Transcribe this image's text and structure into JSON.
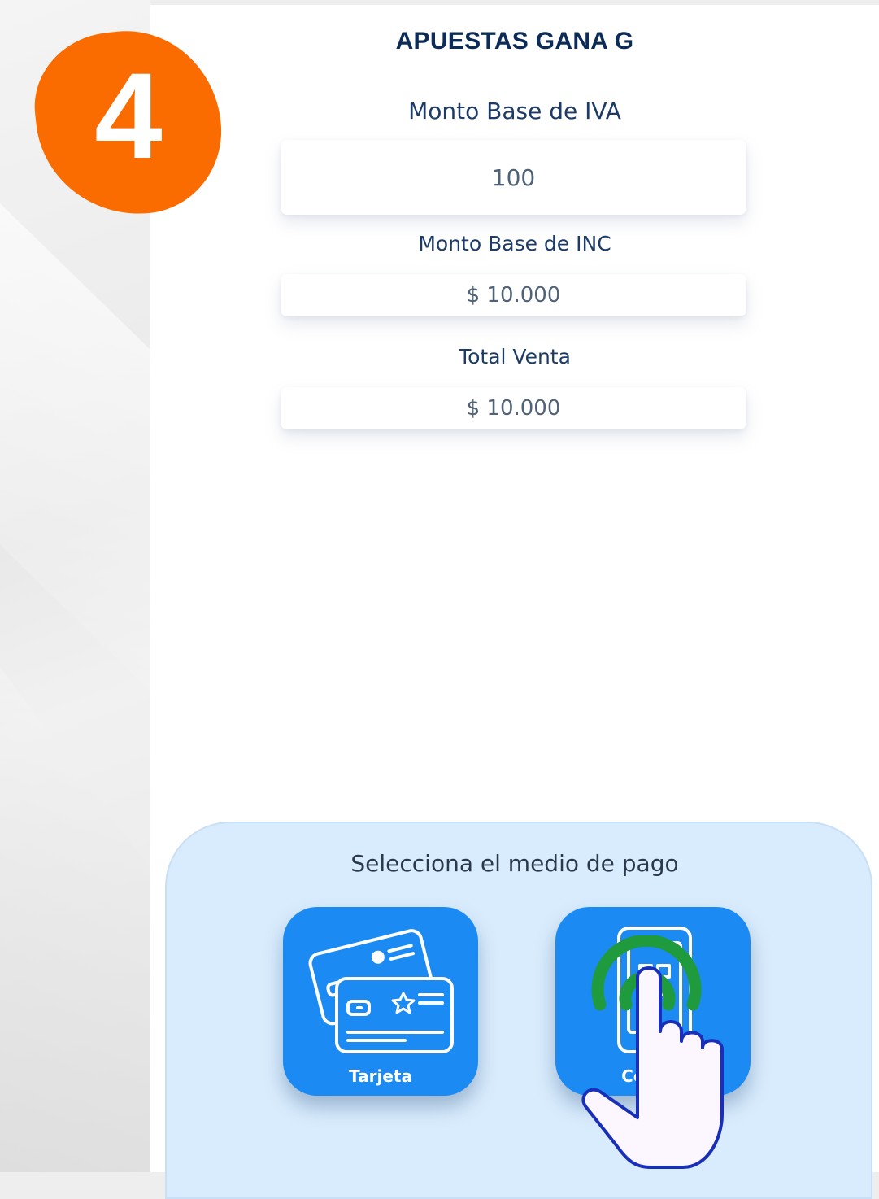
{
  "step_badge": {
    "number": "4",
    "color": "#fb6c00"
  },
  "header": {
    "title": "APUESTAS GANA G"
  },
  "fields": {
    "iva_label": "Monto Base de IVA",
    "iva_value": "100",
    "inc_label": "Monto Base de INC",
    "inc_value": "$ 10.000",
    "total_label": "Total Venta",
    "total_value": "$ 10.000"
  },
  "payment": {
    "title": "Selecciona el medio de pago",
    "options": [
      {
        "label": "Tarjeta",
        "icon": "credit-cards-icon"
      },
      {
        "label": "Código",
        "icon": "phone-qr-icon"
      }
    ],
    "accent": "#1b8bf3",
    "panel_color": "#d9ecfd"
  },
  "tap_indicator": {
    "icon": "hand-pointer-icon",
    "ring_color": "#1f9a3c"
  }
}
